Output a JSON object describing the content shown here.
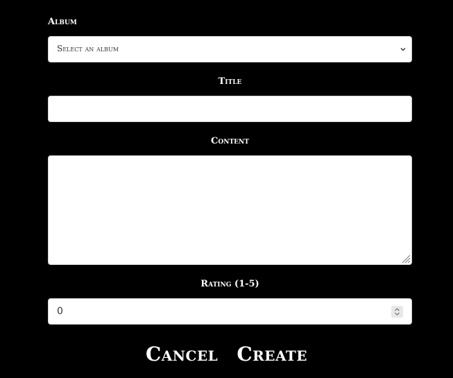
{
  "album": {
    "label": "Album",
    "selected": "Select an album"
  },
  "title": {
    "label": "Title",
    "value": ""
  },
  "content": {
    "label": "Content",
    "value": ""
  },
  "rating": {
    "label": "Rating (1-5)",
    "value": "0"
  },
  "actions": {
    "cancel_label": "Cancel",
    "create_label": "Create"
  },
  "icons": {
    "select_arrow": "chevron-down-icon",
    "resize": "resize-handle-icon",
    "spinner": "number-spinner-icon"
  },
  "colors": {
    "background": "#000000",
    "field": "#ffffff",
    "text": "#ffffff"
  }
}
